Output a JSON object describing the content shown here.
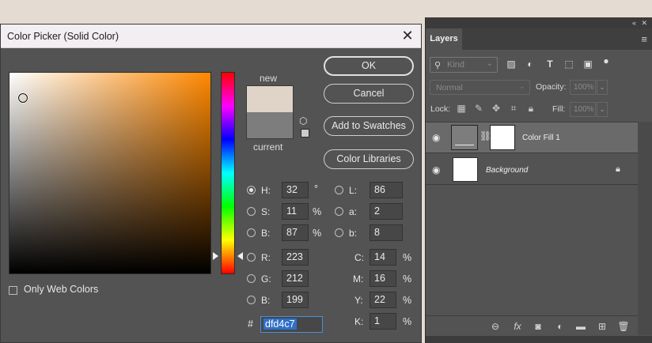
{
  "dialog": {
    "title": "Color Picker (Solid Color)",
    "close_glyph": "✕",
    "web_colors_label": "Only Web Colors",
    "new_label": "new",
    "current_label": "current",
    "new_color": "#dfd4c7",
    "current_color": "#7d7d7d",
    "buttons": {
      "ok": "OK",
      "cancel": "Cancel",
      "add_to_swatches": "Add to Swatches",
      "color_libraries": "Color Libraries"
    },
    "fields": {
      "h": {
        "label": "H:",
        "value": "32",
        "unit": "°"
      },
      "s": {
        "label": "S:",
        "value": "11",
        "unit": "%"
      },
      "b": {
        "label": "B:",
        "value": "87",
        "unit": "%"
      },
      "r": {
        "label": "R:",
        "value": "223"
      },
      "g": {
        "label": "G:",
        "value": "212"
      },
      "bb": {
        "label": "B:",
        "value": "199"
      },
      "l": {
        "label": "L:",
        "value": "86"
      },
      "a": {
        "label": "a:",
        "value": "2"
      },
      "lab_b": {
        "label": "b:",
        "value": "8"
      },
      "c": {
        "label": "C:",
        "value": "14",
        "unit": "%"
      },
      "m": {
        "label": "M:",
        "value": "16",
        "unit": "%"
      },
      "y": {
        "label": "Y:",
        "value": "22",
        "unit": "%"
      },
      "k": {
        "label": "K:",
        "value": "1",
        "unit": "%"
      }
    },
    "hex_label": "#",
    "hex_value": "dfd4c7",
    "selected_mode": "H"
  },
  "layers_panel": {
    "tab_label": "Layers",
    "collapse_glyph": "«",
    "close_glyph": "✕",
    "menu_glyph": "≡",
    "kind_label": "Kind",
    "blend_mode": "Normal",
    "opacity_label": "Opacity:",
    "opacity_value": "100%",
    "lock_label": "Lock:",
    "fill_label": "Fill:",
    "fill_value": "100%",
    "layers": [
      {
        "name": "Color Fill 1",
        "selected": true,
        "visible": true
      },
      {
        "name": "Background",
        "selected": false,
        "visible": true,
        "locked": true
      }
    ],
    "footer_fx_label": "fx"
  }
}
